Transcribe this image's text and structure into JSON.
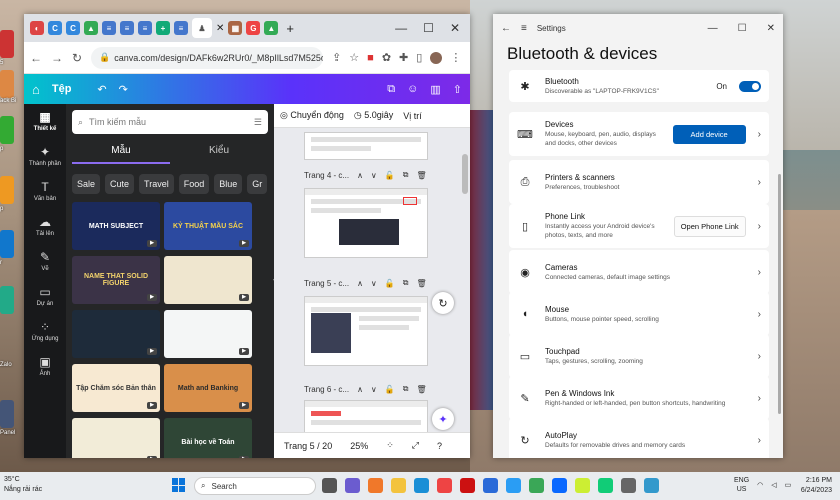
{
  "desktop": {
    "labels": [
      "5",
      "ack Bi",
      "p",
      "p",
      "r",
      "Zalo",
      "Panel"
    ]
  },
  "browser": {
    "tab_icons": [
      "◐",
      "C",
      "C",
      "▲",
      "≡",
      "≡",
      "≡",
      "+",
      "≡",
      "♟",
      "▦",
      "G",
      "▲"
    ],
    "url": "canva.com/design/DAFk6w2RUr0/_M8pIlLsd7M525qeR...",
    "new_tab": "+",
    "canva": {
      "home_label": "Tệp",
      "rail": [
        "Thiết kế",
        "Thành phần",
        "Văn bản",
        "Tải lên",
        "Vẽ",
        "Dự án",
        "Ứng dụng",
        "Ảnh"
      ],
      "search_placeholder": "Tìm kiếm mẫu",
      "tabs": [
        "Mẫu",
        "Kiểu"
      ],
      "chips": [
        "Sale",
        "Cute",
        "Travel",
        "Food",
        "Blue",
        "Gr"
      ],
      "thumbs": [
        "MATH SUBJECT",
        "KỶ THUẬT MẦU SẮC",
        "NAME THAT SOLID FIGURE",
        "",
        "",
        "",
        "Tập Chăm sóc Bản thân",
        "Math and Banking",
        "",
        "Bài học về Toán"
      ],
      "toolbar": {
        "animate": "Chuyển động",
        "duration": "5.0giây",
        "position": "Vị trí"
      },
      "pages": [
        "Trang 4 - c...",
        "Trang 5 - c...",
        "Trang 6 - c..."
      ],
      "footer": {
        "page": "Trang 5 / 20",
        "zoom": "25%"
      }
    }
  },
  "settings": {
    "app": "Settings",
    "heading": "Bluetooth & devices",
    "bluetooth": {
      "title": "Bluetooth",
      "desc": "Discoverable as \"LAPTOP-FRK9V1CS\"",
      "state": "On"
    },
    "items": [
      {
        "title": "Devices",
        "desc": "Mouse, keyboard, pen, audio, displays and docks, other devices",
        "action": "Add device"
      },
      {
        "title": "Printers & scanners",
        "desc": "Preferences, troubleshoot",
        "action": ""
      },
      {
        "title": "Phone Link",
        "desc": "Instantly access your Android device's photos, texts, and more",
        "action": "Open Phone Link"
      },
      {
        "title": "Cameras",
        "desc": "Connected cameras, default image settings",
        "action": ""
      },
      {
        "title": "Mouse",
        "desc": "Buttons, mouse pointer speed, scrolling",
        "action": ""
      },
      {
        "title": "Touchpad",
        "desc": "Taps, gestures, scrolling, zooming",
        "action": ""
      },
      {
        "title": "Pen & Windows Ink",
        "desc": "Right-handed or left-handed, pen button shortcuts, handwriting",
        "action": ""
      },
      {
        "title": "AutoPlay",
        "desc": "Defaults for removable drives and memory cards",
        "action": ""
      }
    ]
  },
  "taskbar": {
    "temp": "35°C",
    "weather": "Nắng rải rác",
    "search": "Search",
    "lang1": "ENG",
    "lang2": "US",
    "time": "2:16 PM",
    "date": "6/24/2023"
  }
}
